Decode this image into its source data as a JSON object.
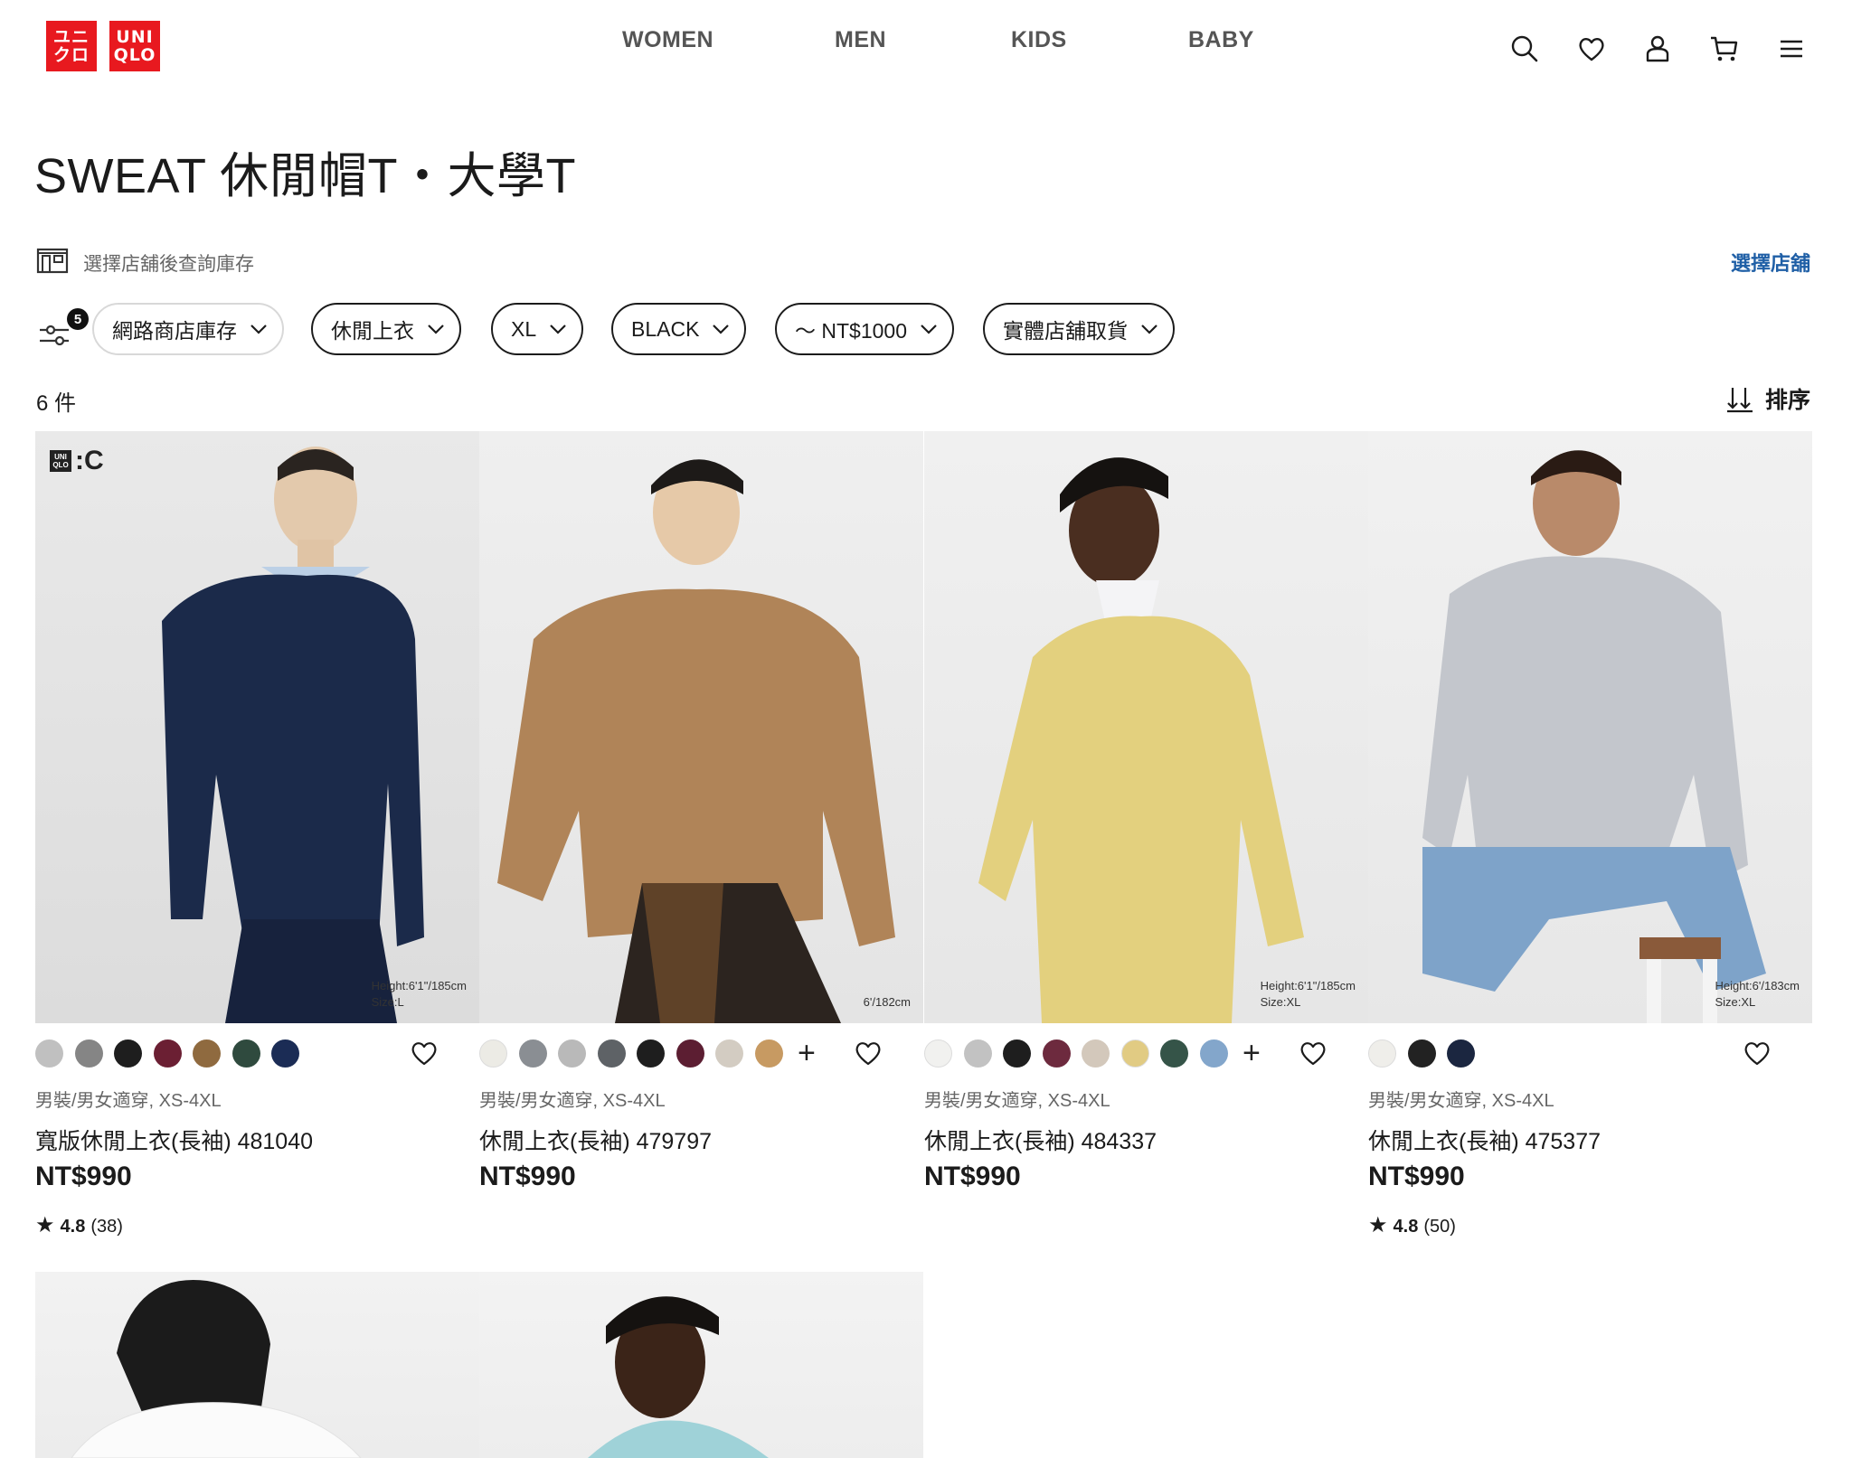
{
  "header": {
    "logo_top": "ユニ\nクロ",
    "logo_bottom": "UNI\nQLO",
    "nav": [
      {
        "label": "WOMEN"
      },
      {
        "label": "MEN"
      },
      {
        "label": "KIDS"
      },
      {
        "label": "BABY"
      }
    ],
    "icons": [
      "search-icon",
      "heart-icon",
      "account-icon",
      "cart-icon",
      "menu-icon"
    ]
  },
  "page": {
    "title": "SWEAT 休閒帽T・大學T"
  },
  "store": {
    "text": "選擇店舖後查詢庫存",
    "link": "選擇店舖"
  },
  "filters": {
    "badge_count": "5",
    "chips": [
      {
        "label": "網路商店庫存"
      },
      {
        "label": "休閒上衣"
      },
      {
        "label": "XL"
      },
      {
        "label": "BLACK"
      },
      {
        "label": "〜 NT$1000"
      },
      {
        "label": "實體店舖取貨"
      }
    ]
  },
  "results": {
    "count": "6 件",
    "sort_label": "排序"
  },
  "products": [
    {
      "badge": "UNI\nQLO",
      "badge_c": ":C",
      "photo_caption": "Height:6'1\"/185cm\nSize:L",
      "swatches": [
        "#c0c0c0",
        "#858585",
        "#1e1e1e",
        "#6b1f33",
        "#8f6a3f",
        "#2f4a3e",
        "#1b2c55"
      ],
      "more": "",
      "gender": "男裝/男女適穿, XS-4XL",
      "name": "寬版休閒上衣(長袖) 481040",
      "price": "NT$990",
      "rating_star": "★",
      "rating_score": "4.8",
      "rating_count": "(38)"
    },
    {
      "photo_caption": "6'/182cm",
      "swatches": [
        "#ecebe5",
        "#8a8e93",
        "#b9b9b9",
        "#5e6266",
        "#1e1e1e",
        "#5c1e32",
        "#d3ccc2",
        "#c79a62"
      ],
      "more": "+",
      "gender": "男裝/男女適穿, XS-4XL",
      "name": "休閒上衣(長袖) 479797",
      "price": "NT$990"
    },
    {
      "photo_caption": "Height:6'1\"/185cm\nSize:XL",
      "swatches": [
        "#f1f1ef",
        "#c2c2c2",
        "#1e1e1e",
        "#6d2a3e",
        "#d3c8bb",
        "#e1cb83",
        "#355448",
        "#83a6cb"
      ],
      "more": "+",
      "gender": "男裝/男女適穿, XS-4XL",
      "name": "休閒上衣(長袖) 484337",
      "price": "NT$990"
    },
    {
      "photo_caption": "Height:6'/183cm\nSize:XL",
      "swatches": [
        "#efeeea",
        "#222222",
        "#1b2640"
      ],
      "more": "",
      "gender": "男裝/男女適穿, XS-4XL",
      "name": "休閒上衣(長袖) 475377",
      "price": "NT$990",
      "rating_star": "★",
      "rating_score": "4.8",
      "rating_count": "(50)"
    }
  ],
  "colors": {
    "brand_red": "#e8191f",
    "link_blue": "#1f5fa6"
  }
}
